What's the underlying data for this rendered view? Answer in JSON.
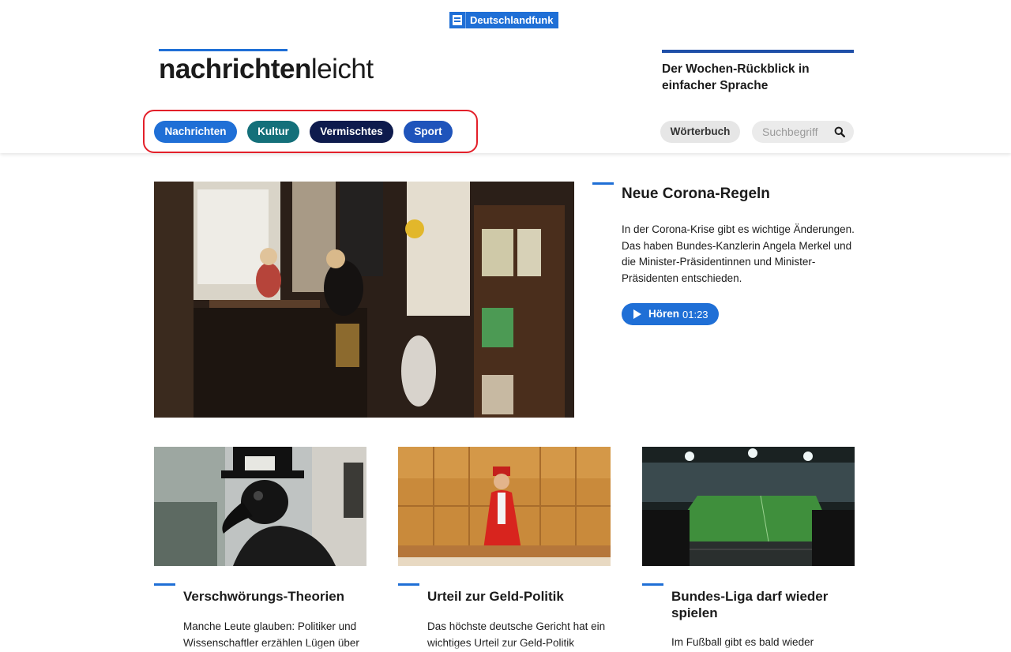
{
  "site": {
    "dlf_logo": "Deutschlandfunk",
    "brand_bold": "nachrichten",
    "brand_light": "leicht",
    "tagline": "Der Wochen-Rückblick in einfacher Sprache"
  },
  "nav": {
    "items": [
      {
        "label": "Nachrichten",
        "color": "#1f6fd6"
      },
      {
        "label": "Kultur",
        "color": "#14707a"
      },
      {
        "label": "Vermischtes",
        "color": "#0e1b4d"
      },
      {
        "label": "Sport",
        "color": "#1f54bb"
      }
    ],
    "highlight_color": "#e3202a"
  },
  "tools": {
    "dictionary_label": "Wörterbuch",
    "search_placeholder": "Suchbegriff",
    "search_icon": "search-icon"
  },
  "hero": {
    "title": "Neue Corona-Regeln",
    "text": "In der Corona-Krise gibt es wichtige Änderungen. Das haben Bundes-Kanzlerin Angela Merkel und die Minister-Präsidentinnen und Minister-Präsidenten entschieden.",
    "listen_label": "Hören",
    "duration": "01:23"
  },
  "cards": [
    {
      "title": "Verschwörungs-Theorien",
      "text": "Manche Leute glauben: Politiker und Wissenschaftler erzählen Lügen über"
    },
    {
      "title": "Urteil zur Geld-Politik",
      "text": "Das höchste deutsche Gericht hat ein wichtiges Urteil zur Geld-Politik"
    },
    {
      "title": "Bundes-Liga darf wieder spielen",
      "text": "Im Fußball gibt es bald wieder"
    }
  ],
  "colors": {
    "accent": "#1f6fd6"
  }
}
